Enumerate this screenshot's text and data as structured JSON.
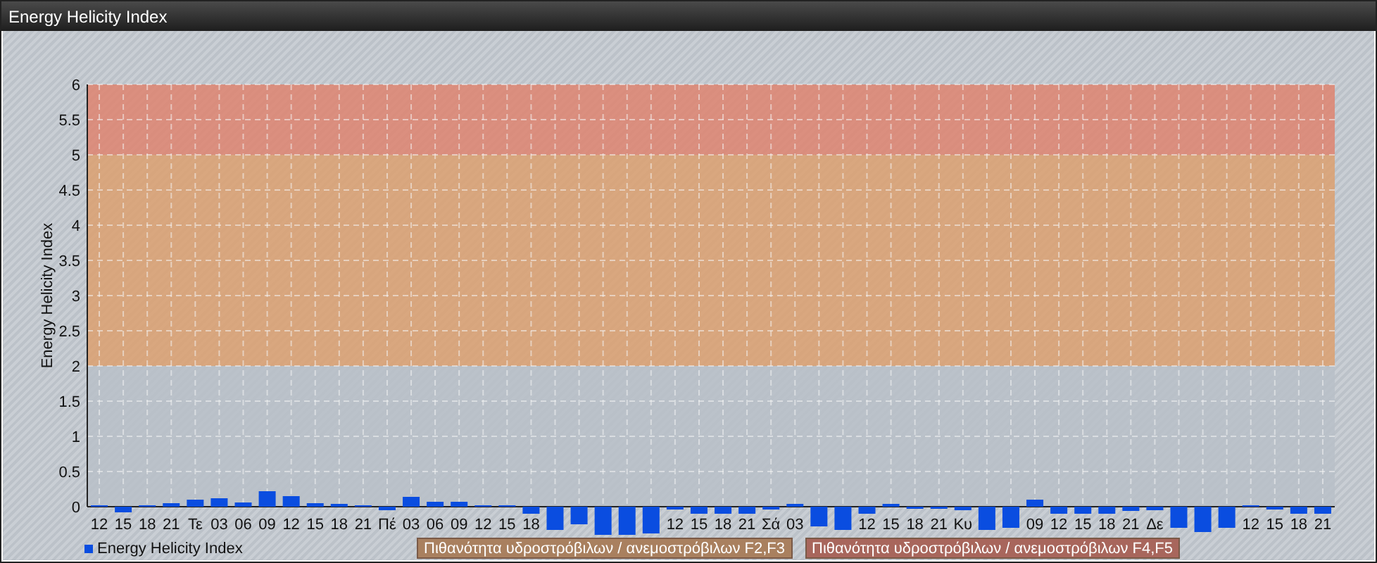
{
  "window": {
    "title": "Energy Helicity Index"
  },
  "chart": {
    "chart_data": {
      "type": "bar",
      "ylabel": "Energy Helicity Index",
      "ylim": [
        -0.45,
        6
      ],
      "yticks": [
        0,
        0.5,
        1,
        1.5,
        2,
        2.5,
        3,
        3.5,
        4,
        4.5,
        5,
        5.5,
        6
      ],
      "grid": true,
      "categories": [
        "12",
        "15",
        "18",
        "21",
        "Τε",
        "03",
        "06",
        "09",
        "12",
        "15",
        "18",
        "21",
        "Πέ",
        "03",
        "06",
        "09",
        "12",
        "15",
        "18",
        null,
        null,
        null,
        null,
        null,
        "12",
        "15",
        "18",
        "21",
        "Σά",
        "03",
        null,
        null,
        "12",
        "15",
        "18",
        "21",
        "Κυ",
        null,
        null,
        "09",
        "12",
        "15",
        "18",
        "21",
        "Δε",
        null,
        null,
        null,
        "12",
        "15",
        "18",
        "21"
      ],
      "series": [
        {
          "name": "Energy Helicity Index",
          "color": "#0a4de0",
          "values": [
            0.02,
            -0.08,
            0.02,
            0.05,
            0.1,
            0.12,
            0.06,
            0.22,
            0.15,
            0.05,
            0.04,
            0.02,
            -0.05,
            0.14,
            0.07,
            0.07,
            0.02,
            0.02,
            -0.1,
            -0.33,
            -0.25,
            -0.4,
            -0.4,
            -0.38,
            -0.04,
            -0.1,
            -0.1,
            -0.1,
            -0.04,
            0.04,
            -0.28,
            -0.33,
            -0.1,
            0.04,
            -0.03,
            -0.03,
            -0.05,
            -0.33,
            -0.3,
            0.1,
            -0.1,
            -0.1,
            -0.1,
            -0.06,
            -0.05,
            -0.3,
            -0.36,
            -0.3,
            0.02,
            -0.04,
            -0.1,
            -0.1
          ]
        }
      ],
      "bands": [
        {
          "axis": "y",
          "from": 0,
          "to": 2,
          "color": "#b8bfc8"
        },
        {
          "axis": "y",
          "from": 2,
          "to": 5,
          "color": "#dca070"
        },
        {
          "axis": "y",
          "from": 5,
          "to": 6,
          "color": "#de8470"
        }
      ]
    },
    "alerts": [
      {
        "label": "Πιθανότητα υδροστρόβιλων / ανεμοστρόβιλων F2,F3",
        "color": "#a9805f"
      },
      {
        "label": "Πιθανότητα υδροστρόβιλων / ανεμοστρόβιλων F4,F5",
        "color": "#a8665c"
      }
    ]
  }
}
